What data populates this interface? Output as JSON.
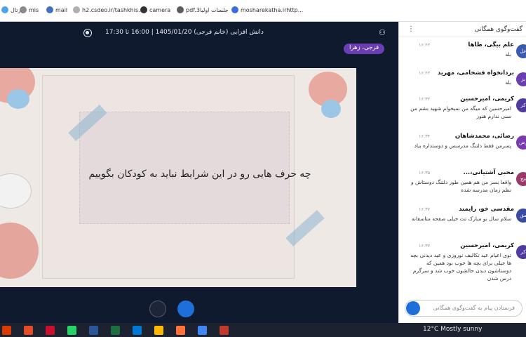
{
  "bookmarks": [
    {
      "label": "پرتال",
      "color": "#4aa4e8"
    },
    {
      "label": "mis",
      "color": "#8a8a8a"
    },
    {
      "label": "mail",
      "color": "#4070c0"
    },
    {
      "label": "h2.csdeo.ir/tashkhis...",
      "color": "#b0b0b0"
    },
    {
      "label": "camera",
      "color": "#333333"
    },
    {
      "label": "pdf.3جلسات اولیا",
      "color": "#5c5c5c"
    },
    {
      "label": "mosharekatha.irhttp...",
      "color": "#3a6ee0"
    }
  ],
  "meeting": {
    "title": "دانش افزایی (خانم فرجی) 1405/01/20 | 16:00 تا 17:30",
    "presenter": "فرجی، زهرا"
  },
  "slide": {
    "text": "چه حرف هایی رو در این شرایط نباید به کودکان بگوییم"
  },
  "chat": {
    "title": "گفت‌وگوی همگانی",
    "input_placeholder": "فرستادن پیام به گفت‌وگوی همگانی",
    "messages": [
      {
        "avatar": "عل",
        "avatar_color": "#3a5ab0",
        "name": "علم بیگی، طاها",
        "time": "۱۶:۲۲",
        "text": "بله"
      },
      {
        "avatar": "بز",
        "avatar_color": "#6a3db0",
        "name": "بردانخواه فشخامی، مهرید",
        "time": "۱۶:۲۲",
        "text": "بله"
      },
      {
        "avatar": "کر",
        "avatar_color": "#4f3a9e",
        "name": "کریمی، امیرحسین",
        "time": "۱۶:۳۲",
        "text": "امیرحسین که میگه من نمیخوام شهید بشم من سنی ندارم هنوز"
      },
      {
        "avatar": "رض",
        "avatar_color": "#7a3ab0",
        "name": "رضائی، محمدشاهان",
        "time": "۱۶:۳۴",
        "text": "پسرمن فقط دلتنگ مدرسس و دوستداره بیاد"
      },
      {
        "avatar": "مح",
        "avatar_color": "#9a3a6a",
        "name": "محبی آشتیانی،...",
        "time": "۱۶:۳۵",
        "text": "واقعا بسر من هم همین طور دلتنگ دوستاش و نظم زمان مدرسه شده"
      },
      {
        "avatar": "مق",
        "avatar_color": "#3a4aa0",
        "name": "مقدسی خو، رایمند",
        "time": "۱۶:۳۷",
        "text": "سلام سال نو مبارک تت خیلی صفحه متاسفانه"
      },
      {
        "avatar": "کر",
        "avatar_color": "#4f3a9e",
        "name": "کریمی، امیرحسین",
        "time": "۱۶:۳۷",
        "text": "توی اعیام عید تکالیف نوروزی و عید دیدنی بچه ها خیلی برای بچه ها خوب بود همین که دوستاشون دیدن حالشون خوب شد و سرگرم درس شدن"
      }
    ]
  },
  "taskbar": {
    "weather": "12°C  Mostly sunny",
    "apps": [
      "#d83b01",
      "#e34c26",
      "#c8102e",
      "#25d366",
      "#2b579a",
      "#1d6f42",
      "#0078d4",
      "#ffb900",
      "#ff7139",
      "#4285f4",
      "#c0392b"
    ]
  }
}
